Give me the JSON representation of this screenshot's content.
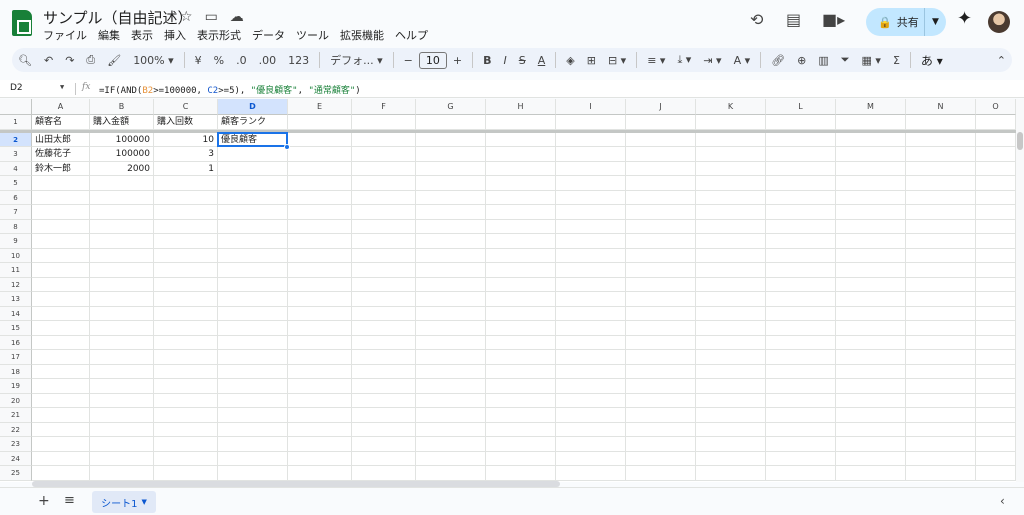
{
  "doc": {
    "title": "サンプル（自由記述）"
  },
  "menu": [
    "ファイル",
    "編集",
    "表示",
    "挿入",
    "表示形式",
    "データ",
    "ツール",
    "拡張機能",
    "ヘルプ"
  ],
  "header": {
    "share_label": "共有"
  },
  "toolbar": {
    "zoom": "100%",
    "currency": "¥",
    "percent": "%",
    "dec_minus": ".0",
    "dec_plus": ".00",
    "format_123": "123",
    "font": "デフォ...",
    "font_size": "10",
    "sum": "Σ",
    "input_mode": "あ"
  },
  "formula_bar": {
    "name_box": "D2",
    "fx": "fx",
    "formula": {
      "p1": "=IF(AND(",
      "r1": "B2",
      "p2": ">=100000, ",
      "r2": "C2",
      "p3": ">=5), ",
      "s1": "\"優良顧客\"",
      "p4": ", ",
      "s2": "\"通常顧客\"",
      "p5": ")"
    }
  },
  "columns": [
    "A",
    "B",
    "C",
    "D",
    "E",
    "F",
    "G",
    "H",
    "I",
    "J",
    "K",
    "L",
    "M",
    "N",
    "O"
  ],
  "rows": [
    "1",
    "2",
    "3",
    "4",
    "5",
    "6",
    "7",
    "8",
    "9",
    "10",
    "11",
    "12",
    "13",
    "14",
    "15",
    "16",
    "17",
    "18",
    "19",
    "20",
    "21",
    "22",
    "23",
    "24",
    "25"
  ],
  "cells": {
    "r1": [
      "顧客名",
      "購入金額",
      "購入回数",
      "顧客ランク"
    ],
    "r2": [
      "山田太郎",
      "100000",
      "10",
      "優良顧客"
    ],
    "r3": [
      "佐藤花子",
      "100000",
      "3",
      ""
    ],
    "r4": [
      "鈴木一郎",
      "2000",
      "1",
      ""
    ]
  },
  "sheets": {
    "active": "シート1"
  }
}
